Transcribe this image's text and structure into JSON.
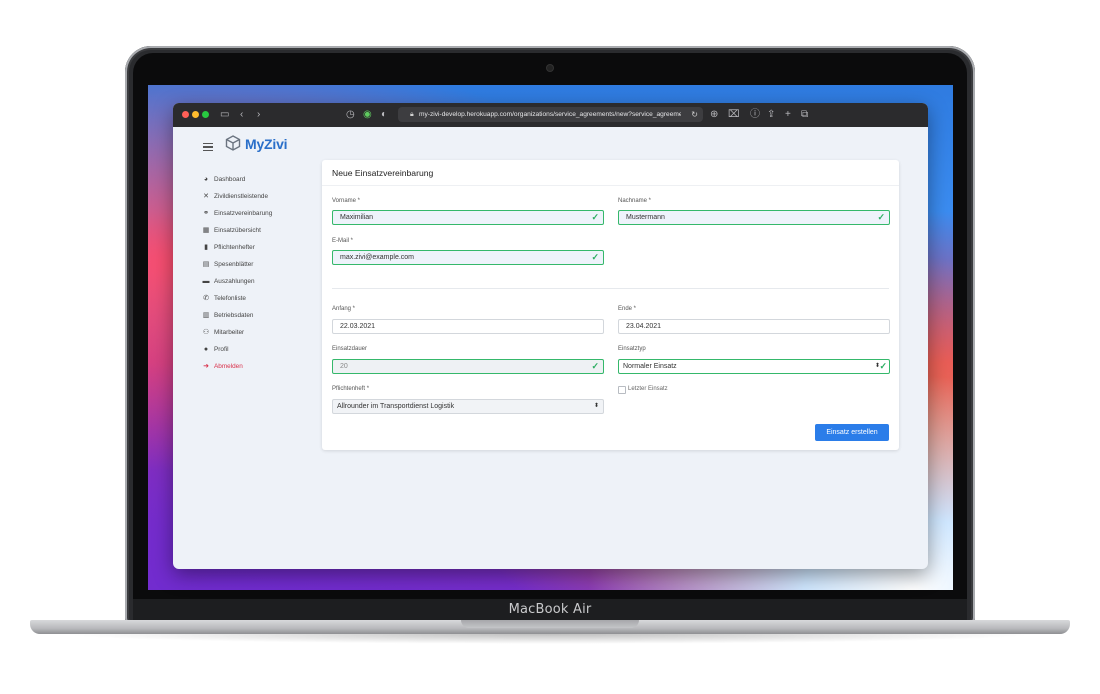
{
  "device": {
    "label": "MacBook Air"
  },
  "browser": {
    "url": "my-zivi-develop.herokuapp.com/organizations/service_agreements/new?service_agreement"
  },
  "app": {
    "brand": "MyZivi",
    "sidebar": {
      "items": [
        {
          "label": "Dashboard",
          "icon": "dashboard-icon"
        },
        {
          "label": "Zivildienstleistende",
          "icon": "tools-icon"
        },
        {
          "label": "Einsatzvereinbarung",
          "icon": "handshake-icon"
        },
        {
          "label": "Einsatzübersicht",
          "icon": "calendar-icon"
        },
        {
          "label": "Pflichtenhefter",
          "icon": "file-icon"
        },
        {
          "label": "Spesenblätter",
          "icon": "receipt-icon"
        },
        {
          "label": "Auszahlungen",
          "icon": "wallet-icon"
        },
        {
          "label": "Telefonliste",
          "icon": "phone-icon"
        },
        {
          "label": "Betriebsdaten",
          "icon": "building-icon"
        },
        {
          "label": "Mitarbeiter",
          "icon": "users-icon"
        },
        {
          "label": "Profil",
          "icon": "user-icon"
        },
        {
          "label": "Abmelden",
          "icon": "sign-out-icon",
          "color": "#d9304a"
        }
      ]
    },
    "form": {
      "title": "Neue Einsatzvereinbarung",
      "vorname": {
        "label": "Vorname *",
        "value": "Maximilian"
      },
      "nachname": {
        "label": "Nachname *",
        "value": "Mustermann"
      },
      "email": {
        "label": "E-Mail *",
        "value": "max.zivi@example.com"
      },
      "anfang": {
        "label": "Anfang *",
        "value": "22.03.2021"
      },
      "ende": {
        "label": "Ende *",
        "value": "23.04.2021"
      },
      "einsatzdauer": {
        "label": "Einsatzdauer",
        "value": "20"
      },
      "einsatztyp": {
        "label": "Einsatztyp",
        "value": "Normaler Einsatz"
      },
      "pflichtenheft": {
        "label": "Pflichtenheft *",
        "value": "Allrounder im Transportdienst Logistik"
      },
      "letzter_einsatz": {
        "label": "Letzter Einsatz",
        "checked": false
      },
      "submit_label": "Einsatz erstellen"
    }
  },
  "colors": {
    "accent": "#2b7de9",
    "valid": "#35b86b",
    "brand": "#2a6fc9",
    "danger": "#d9304a"
  }
}
